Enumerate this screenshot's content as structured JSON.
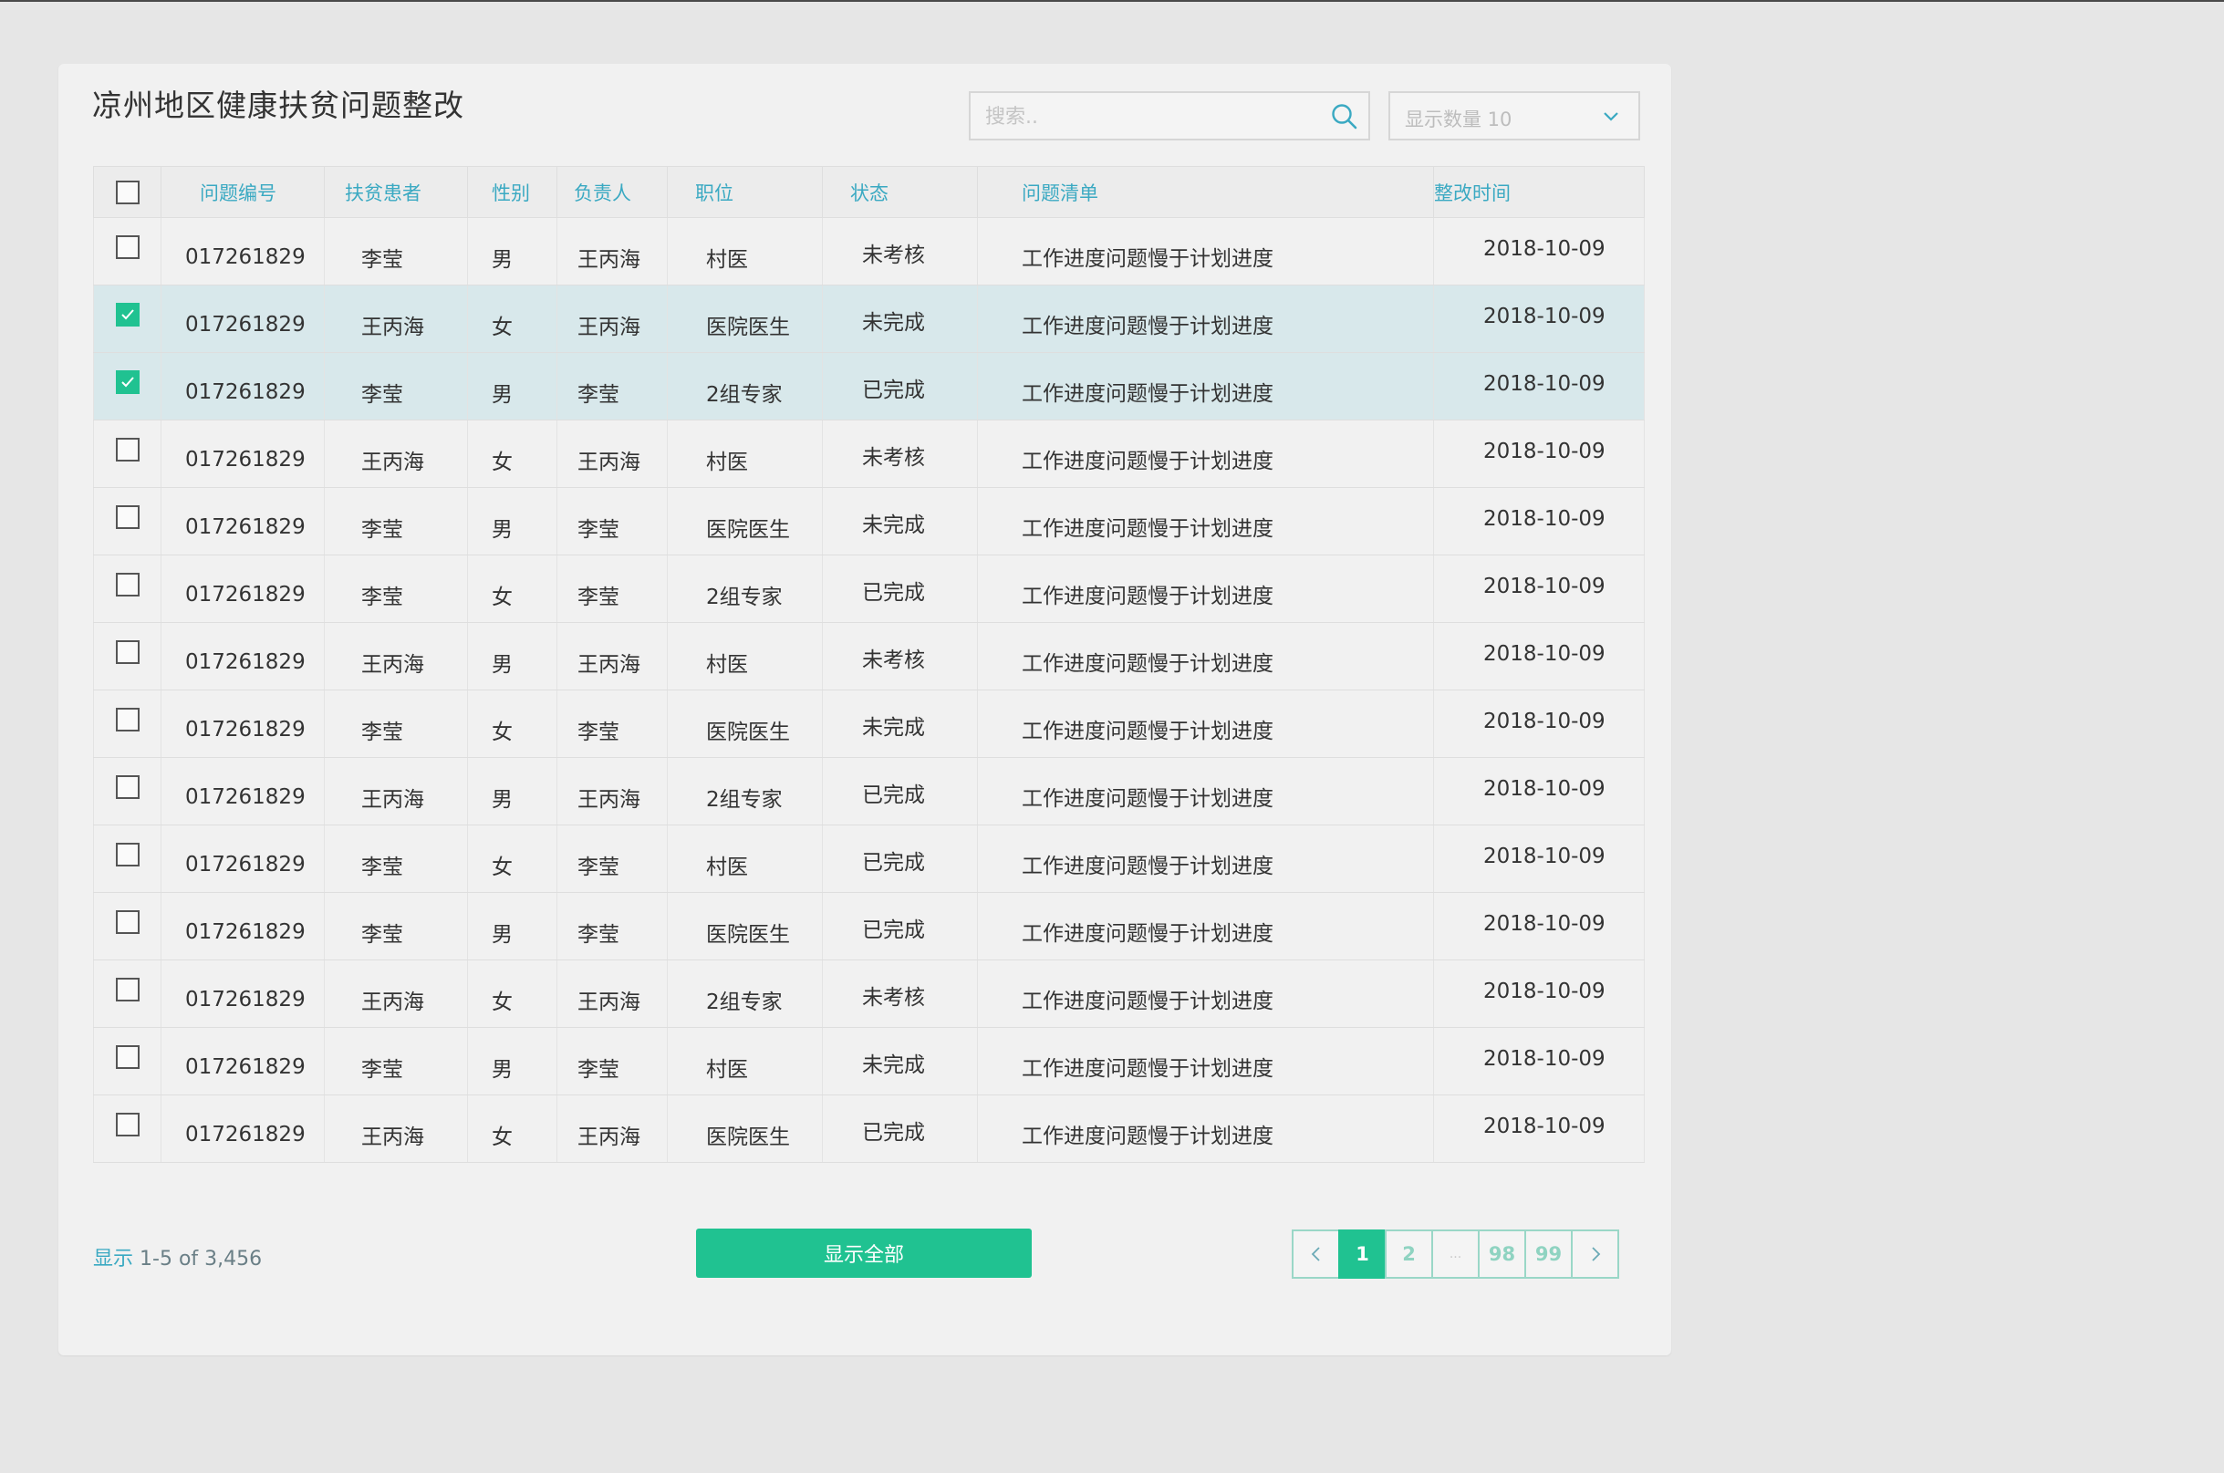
{
  "header": {
    "title": "凉州地区健康扶贫问题整改",
    "search_placeholder": "搜索..",
    "page_size_label": "显示数量 10"
  },
  "table": {
    "columns": [
      "问题编号",
      "扶贫患者",
      "性别",
      "负责人",
      "职位",
      "状态",
      "问题清单",
      "整改时间"
    ],
    "rows": [
      {
        "checked": false,
        "id": "017261829",
        "patient": "李莹",
        "gender": "男",
        "owner": "王丙海",
        "position": "村医",
        "status": "未考核",
        "status_type": "gray",
        "issue": "工作进度问题慢于计划进度",
        "date": "2018-10-09"
      },
      {
        "checked": true,
        "id": "017261829",
        "patient": "王丙海",
        "gender": "女",
        "owner": "王丙海",
        "position": "医院医生",
        "status": "未完成",
        "status_type": "red",
        "issue": "工作进度问题慢于计划进度",
        "date": "2018-10-09"
      },
      {
        "checked": true,
        "id": "017261829",
        "patient": "李莹",
        "gender": "男",
        "owner": "李莹",
        "position": "2组专家",
        "status": "已完成",
        "status_type": "green",
        "issue": "工作进度问题慢于计划进度",
        "date": "2018-10-09"
      },
      {
        "checked": false,
        "id": "017261829",
        "patient": "王丙海",
        "gender": "女",
        "owner": "王丙海",
        "position": "村医",
        "status": "未考核",
        "status_type": "gray",
        "issue": "工作进度问题慢于计划进度",
        "date": "2018-10-09"
      },
      {
        "checked": false,
        "id": "017261829",
        "patient": "李莹",
        "gender": "男",
        "owner": "李莹",
        "position": "医院医生",
        "status": "未完成",
        "status_type": "red",
        "issue": "工作进度问题慢于计划进度",
        "date": "2018-10-09"
      },
      {
        "checked": false,
        "id": "017261829",
        "patient": "李莹",
        "gender": "女",
        "owner": "李莹",
        "position": "2组专家",
        "status": "已完成",
        "status_type": "green",
        "issue": "工作进度问题慢于计划进度",
        "date": "2018-10-09"
      },
      {
        "checked": false,
        "id": "017261829",
        "patient": "王丙海",
        "gender": "男",
        "owner": "王丙海",
        "position": "村医",
        "status": "未考核",
        "status_type": "gray",
        "issue": "工作进度问题慢于计划进度",
        "date": "2018-10-09"
      },
      {
        "checked": false,
        "id": "017261829",
        "patient": "李莹",
        "gender": "女",
        "owner": "李莹",
        "position": "医院医生",
        "status": "未完成",
        "status_type": "red",
        "issue": "工作进度问题慢于计划进度",
        "date": "2018-10-09"
      },
      {
        "checked": false,
        "id": "017261829",
        "patient": "王丙海",
        "gender": "男",
        "owner": "王丙海",
        "position": "2组专家",
        "status": "已完成",
        "status_type": "green",
        "issue": "工作进度问题慢于计划进度",
        "date": "2018-10-09"
      },
      {
        "checked": false,
        "id": "017261829",
        "patient": "李莹",
        "gender": "女",
        "owner": "李莹",
        "position": "村医",
        "status": "已完成",
        "status_type": "green",
        "issue": "工作进度问题慢于计划进度",
        "date": "2018-10-09"
      },
      {
        "checked": false,
        "id": "017261829",
        "patient": "李莹",
        "gender": "男",
        "owner": "李莹",
        "position": "医院医生",
        "status": "已完成",
        "status_type": "green",
        "issue": "工作进度问题慢于计划进度",
        "date": "2018-10-09"
      },
      {
        "checked": false,
        "id": "017261829",
        "patient": "王丙海",
        "gender": "女",
        "owner": "王丙海",
        "position": "2组专家",
        "status": "未考核",
        "status_type": "gray",
        "issue": "工作进度问题慢于计划进度",
        "date": "2018-10-09"
      },
      {
        "checked": false,
        "id": "017261829",
        "patient": "李莹",
        "gender": "男",
        "owner": "李莹",
        "position": "村医",
        "status": "未完成",
        "status_type": "red",
        "issue": "工作进度问题慢于计划进度",
        "date": "2018-10-09"
      },
      {
        "checked": false,
        "id": "017261829",
        "patient": "王丙海",
        "gender": "女",
        "owner": "王丙海",
        "position": "医院医生",
        "status": "已完成",
        "status_type": "green",
        "issue": "工作进度问题慢于计划进度",
        "date": "2018-10-09"
      }
    ]
  },
  "footer": {
    "info_prefix": "显示",
    "info_range": "1-5 of 3,456",
    "show_all_label": "显示全部",
    "pagination": [
      "<",
      "1",
      "2",
      "...",
      "98",
      "99",
      ">"
    ],
    "active_page": "1"
  },
  "colors": {
    "accent": "#20c291",
    "header_text": "#3aa9c2",
    "status_gray": "#9a9a9a",
    "status_red": "#c81e1e",
    "status_green": "#3fbf3f",
    "selected_row": "#d8e8eb"
  },
  "icons": {
    "search": "search-icon",
    "dropdown": "chevron-down-icon",
    "checkbox_checked": "checkmark-icon",
    "prev": "chevron-left-icon",
    "next": "chevron-right-icon"
  }
}
